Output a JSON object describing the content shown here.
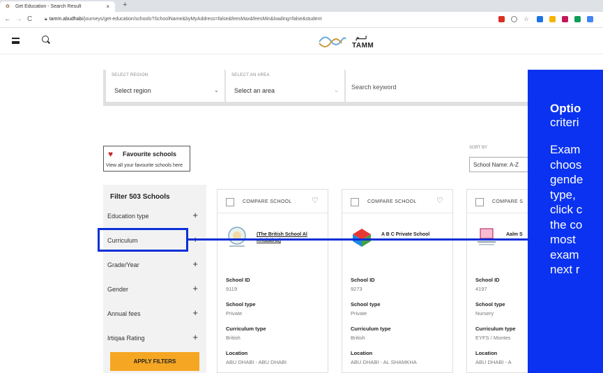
{
  "browser": {
    "tab_title": "Get Education - Search Result",
    "tab_close": "×",
    "new_tab": "+",
    "url_host": "tamm.abudhabi",
    "url_path": "/journeys/get-education/schools?SchoolName&byMyAddress=false&feesMax&feesMin&loading=false&student",
    "nav_back": "←",
    "nav_forward": "→",
    "nav_reload": "C"
  },
  "header": {
    "logo_text": "TAMM",
    "logo_arabic": "تـــم"
  },
  "search": {
    "region_caption": "SELECT REGION",
    "region_value": "Select region",
    "area_caption": "SELECT AN AREA",
    "area_value": "Select an area",
    "keyword_placeholder": "Search keyword"
  },
  "favourites": {
    "title": "Favourite schools",
    "subtitle": "View all your favourite schools here"
  },
  "filter": {
    "header": "Filter 503 Schools",
    "items": [
      {
        "label": "Education type"
      },
      {
        "label": "Curriculum"
      },
      {
        "label": "Grade/Year"
      },
      {
        "label": "Gender"
      },
      {
        "label": "Annual fees"
      },
      {
        "label": "Irtiqaa Rating"
      }
    ],
    "apply_label": "APPLY FILTERS"
  },
  "sort": {
    "caption": "SORT BY",
    "value": "School Name: A-Z"
  },
  "cards": [
    {
      "compare_label": "COMPARE SCHOOL",
      "name": "(The British School Al Khubairat)",
      "id_label": "School ID",
      "id_value": "9119",
      "type_label": "School type",
      "type_value": "Private",
      "curriculum_label": "Curriculum type",
      "curriculum_value": "British",
      "location_label": "Location",
      "location_value": "ABU DHABI - ABU DHABI"
    },
    {
      "compare_label": "COMPARE SCHOOL",
      "name": "A B C Private School",
      "id_label": "School ID",
      "id_value": "9273",
      "type_label": "School type",
      "type_value": "Private",
      "curriculum_label": "Curriculum type",
      "curriculum_value": "British",
      "location_label": "Location",
      "location_value": "ABU DHABI - AL SHAMKHA"
    },
    {
      "compare_label": "COMPARE S",
      "name": "Aalm S",
      "id_label": "School ID",
      "id_value": "4197",
      "type_label": "School type",
      "type_value": "Nursery",
      "curriculum_label": "Curriculum type",
      "curriculum_value": "EYFS / Montes",
      "location_label": "Location",
      "location_value": "ABU DHABI - A"
    }
  ],
  "overlay": {
    "heading": "Optio",
    "heading2": "criteri",
    "lines": [
      "Exam",
      "choos",
      "gende",
      "type,",
      "click c",
      "the co",
      "most",
      "exam",
      "next r"
    ]
  },
  "colors": {
    "overlay_blue": "#0a32f0",
    "highlight_blue": "#0a2fd6",
    "apply_orange": "#f5a623",
    "heart_red": "#c62828"
  }
}
